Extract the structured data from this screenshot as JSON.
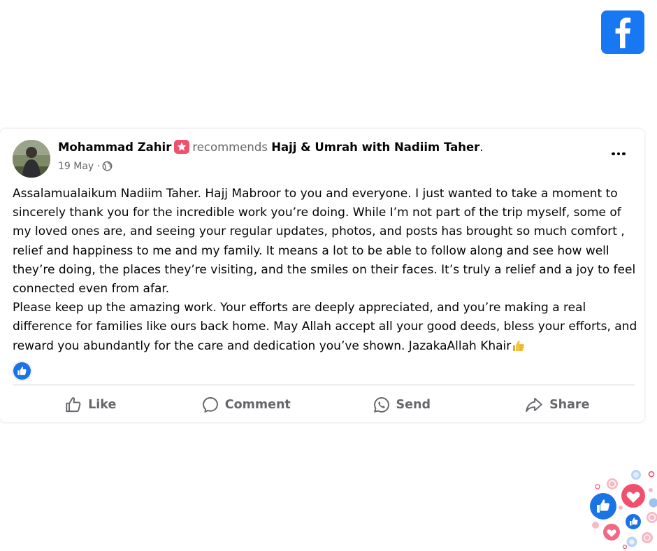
{
  "post": {
    "author": "Mohammad Zahir",
    "action": "recommends",
    "page": "Hajj & Umrah with Nadiim Taher",
    "period": ".",
    "date": "19 May",
    "separator": "·",
    "paragraph1": "Assalamualaikum Nadiim Taher. Hajj Mabroor to you and everyone. I just wanted to take a moment to sincerely thank you for the incredible work you’re doing. While I’m not part of the trip myself, some of my loved ones are, and seeing your regular updates, photos, and posts has brought so much comfort , relief and happiness to me and my family. It means a lot to be able to follow along and see how well they’re doing, the places they’re visiting, and the smiles on their faces. It’s truly a relief and a joy to feel connected even from afar.",
    "paragraph2": "Please keep up the amazing work. Your efforts are deeply appreciated, and you’re making a real difference for families like ours back home. May Allah accept all your good deeds, bless your efforts, and reward you abundantly for the care and dedication you’ve shown. JazakaAllah Khair",
    "reaction_icon": "like-reaction-icon"
  },
  "actions": {
    "like": "Like",
    "comment": "Comment",
    "send": "Send",
    "share": "Share"
  },
  "colors": {
    "facebook_blue": "#1877f2",
    "secondary_text": "#65676b",
    "badge_pink": "#f0506e",
    "reaction_red": "#f0506e"
  }
}
